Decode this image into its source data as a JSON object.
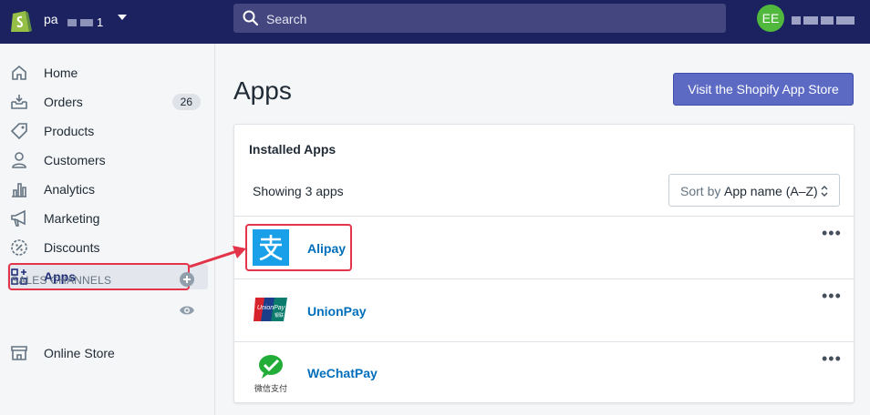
{
  "topbar": {
    "store_name": "pa",
    "store_suffix": "1",
    "search_placeholder": "Search",
    "avatar_initials": "EE"
  },
  "sidebar": {
    "items": [
      {
        "label": "Home",
        "icon": "home-icon"
      },
      {
        "label": "Orders",
        "icon": "orders-icon",
        "badge": "26"
      },
      {
        "label": "Products",
        "icon": "tag-icon"
      },
      {
        "label": "Customers",
        "icon": "person-icon"
      },
      {
        "label": "Analytics",
        "icon": "bar-chart-icon"
      },
      {
        "label": "Marketing",
        "icon": "megaphone-icon"
      },
      {
        "label": "Discounts",
        "icon": "discount-icon"
      },
      {
        "label": "Apps",
        "icon": "apps-icon",
        "active": true
      }
    ],
    "sales_channels_title": "SALES CHANNELS",
    "online_store_label": "Online Store"
  },
  "main": {
    "title": "Apps",
    "store_button": "Visit the Shopify App Store",
    "card_title": "Installed Apps",
    "showing": "Showing 3 apps",
    "sort_label": "Sort by",
    "sort_value": "App name (A–Z)",
    "apps": [
      {
        "name": "Alipay",
        "icon": "alipay-logo"
      },
      {
        "name": "UnionPay",
        "icon": "unionpay-logo"
      },
      {
        "name": "WeChatPay",
        "icon": "wechatpay-logo",
        "logo_caption": "微信支付"
      }
    ]
  },
  "colors": {
    "topbar": "#1c2260",
    "primary_button": "#5c6ac4",
    "link": "#006fbb",
    "highlight": "#e3344a"
  }
}
